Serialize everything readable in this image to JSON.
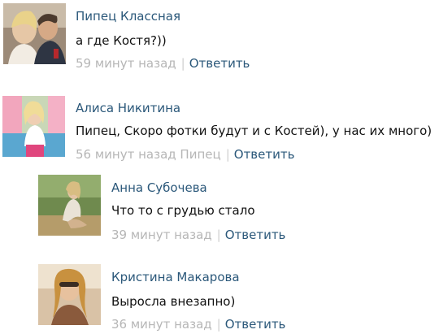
{
  "comments": [
    {
      "author": "Пипец Классная",
      "text": "а где Костя?))",
      "time": "59 минут назад",
      "reply": "Ответить"
    },
    {
      "author": "Алиса Никитина",
      "text": "Пипец, Скоро фотки будут и с Костей), у нас их много)",
      "time": "56 минут назад Пипец",
      "reply": "Ответить"
    },
    {
      "author": "Анна Субочева",
      "text": "Что то с грудью стало",
      "time": "39 минут назад",
      "reply": "Ответить"
    },
    {
      "author": "Кристина Макарова",
      "text": "Выросла внезапно)",
      "time": "36 минут назад",
      "reply": "Ответить"
    }
  ],
  "separator": "|",
  "colors": {
    "author": "#2b587a",
    "link": "#2b587a",
    "meta": "#b6b6b6",
    "text": "#111111"
  }
}
